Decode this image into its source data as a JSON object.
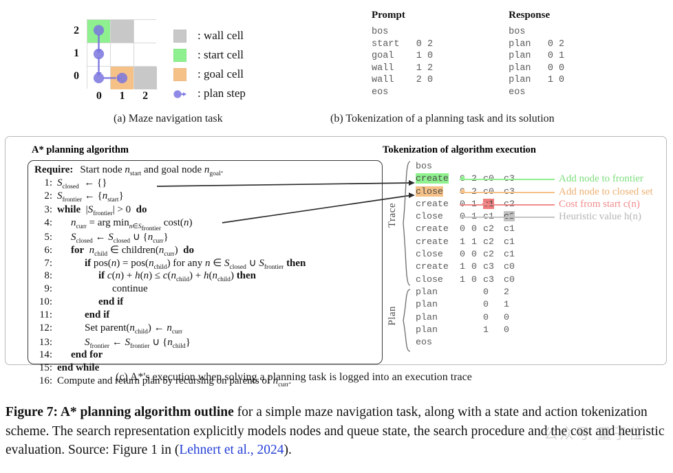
{
  "maze": {
    "y_labels": [
      "2",
      "1",
      "0"
    ],
    "x_labels": [
      "0",
      "1",
      "2"
    ],
    "colors": {
      "wall": "#c8c8c8",
      "start": "#8ef08e",
      "goal": "#f5c187",
      "plan_step": "#7b76e0",
      "empty": "#ffffff"
    },
    "cells": [
      [
        "start",
        "wall",
        "empty"
      ],
      [
        "empty",
        "empty",
        "empty"
      ],
      [
        "empty",
        "goal",
        "wall"
      ]
    ]
  },
  "legend": {
    "items": [
      {
        "icon": "gray-square-swatch",
        "label": ": wall cell"
      },
      {
        "icon": "green-square-swatch",
        "label": ": start cell"
      },
      {
        "icon": "orange-square-swatch",
        "label": ": goal cell"
      },
      {
        "icon": "purple-dot-arrow-icon",
        "label": ": plan step"
      }
    ]
  },
  "tokenization_task": {
    "prompt_header": "Prompt",
    "response_header": "Response",
    "prompt_lines": [
      "bos",
      "start   0 2",
      "goal    1 0",
      "wall    1 2",
      "wall    2 0",
      "eos"
    ],
    "response_lines": [
      "bos",
      "plan   0 2",
      "plan   0 1",
      "plan   0 0",
      "plan   1 0",
      "eos"
    ]
  },
  "subcaptions": {
    "a": "(a) Maze navigation task",
    "b": "(b) Tokenization of a planning task and its solution",
    "c": "(c) A*'s execution when solving a planning task is logged into an execution trace"
  },
  "panel_c": {
    "algo_title": "A* planning algorithm",
    "tok_title": "Tokenization of algorithm execution",
    "algo_lines": [
      {
        "num": "Require:",
        "require": true,
        "indent": 0,
        "html": "<span style=\"margin-left:5px\">Start node <i class='mv'>n</i><sub>start</sub> and goal node <i class='mv'>n</i><sub>goal</sub>.</span>"
      },
      {
        "num": "1:",
        "indent": 0,
        "html": "<i class='cal'>S</i><sub>closed</sub> &nbsp;&#8592; {}"
      },
      {
        "num": "2:",
        "indent": 0,
        "html": "<i class='cal'>S</i><sub>frontier</sub> &#8592; {<i class='mv'>n</i><sub>start</sub>}"
      },
      {
        "num": "3:",
        "indent": 0,
        "html": "<b class='kw'>while</b> &nbsp;|<i class='cal'>S</i><sub>frontier</sub>| &gt; 0 &nbsp;<b class='kw'>do</b>"
      },
      {
        "num": "4:",
        "indent": 1,
        "html": "<i class='mv'>n</i><sub>curr</sub> = arg min<sub><i>n</i>&#8712;<i>S</i><sub>frontier</sub></sub> cost(<i class='mv'>n</i>)"
      },
      {
        "num": "5:",
        "indent": 1,
        "html": "<i class='cal'>S</i><sub>closed</sub> &#8592; <i class='cal'>S</i><sub>closed</sub> &#8746; {<i class='mv'>n</i><sub>curr</sub>}"
      },
      {
        "num": "6:",
        "indent": 1,
        "html": "<b class='kw'>for</b> &nbsp;<i class='mv'>n</i><sub>child</sub> &#8712; children(<i class='mv'>n</i><sub>curr</sub>) &nbsp;<b class='kw'>do</b>"
      },
      {
        "num": "7:",
        "indent": 2,
        "html": "<b class='kw'>if</b> pos(<i class='mv'>n</i>) = pos(<i class='mv'>n</i><sub>child</sub>) for any <i class='mv'>n</i> &#8712; <i class='cal'>S</i><sub>closed</sub> &#8746; <i class='cal'>S</i><sub>frontier</sub> <b class='kw'>then</b>"
      },
      {
        "num": "8:",
        "indent": 3,
        "html": "<b class='kw'>if</b> <i class='mv'>c</i>(<i class='mv'>n</i>) + <i class='mv'>h</i>(<i class='mv'>n</i>) &#8804; <i class='mv'>c</i>(<i class='mv'>n</i><sub>child</sub>) + <i class='mv'>h</i>(<i class='mv'>n</i><sub>child</sub>) <b class='kw'>then</b>"
      },
      {
        "num": "9:",
        "indent": 4,
        "html": "continue"
      },
      {
        "num": "10:",
        "indent": 3,
        "html": "<b class='kw'>end if</b>"
      },
      {
        "num": "11:",
        "indent": 2,
        "html": "<b class='kw'>end if</b>"
      },
      {
        "num": "12:",
        "indent": 2,
        "html": "Set parent(<i class='mv'>n</i><sub>child</sub>) &#8592; <i class='mv'>n</i><sub>curr</sub>"
      },
      {
        "num": "13:",
        "indent": 2,
        "html": "<i class='cal'>S</i><sub>frontier</sub> &#8592; <i class='cal'>S</i><sub>frontier</sub> &#8746; {<i class='mv'>n</i><sub>child</sub>}"
      },
      {
        "num": "14:",
        "indent": 1,
        "html": "<b class='kw'>end for</b>"
      },
      {
        "num": "15:",
        "indent": 0,
        "html": "<b class='kw'>end while</b>"
      },
      {
        "num": "16:",
        "indent": 0,
        "html": "Compute and return plan by recursing on parents of <i class='mv'>n</i><sub>curr</sub>."
      }
    ],
    "trace_label": "Trace",
    "plan_label": "Plan",
    "trace_rows": [
      {
        "op": "bos",
        "args": [],
        "hl": []
      },
      {
        "op": "create",
        "args": [
          "0",
          "2",
          "c0",
          "c3"
        ],
        "hl": [
          "op"
        ],
        "annot": "Add node to frontier",
        "annot_class": "an-green",
        "strike": "#8ef08e"
      },
      {
        "op": "close",
        "args": [
          "0",
          "2",
          "c0",
          "c3"
        ],
        "hl": [
          "op"
        ],
        "annot": "Add node to closed set",
        "annot_class": "an-orange",
        "strike": "#f5c187"
      },
      {
        "op": "create",
        "args": [
          "0",
          "1",
          "c1",
          "c2"
        ],
        "hl": [
          "a3"
        ],
        "annot": "Cost from start c(n)",
        "annot_class": "an-red",
        "strike": "#f08b8b"
      },
      {
        "op": "close",
        "args": [
          "0",
          "1",
          "c1",
          "c2"
        ],
        "hl": [
          "a4"
        ],
        "annot": "Heuristic value h(n)",
        "annot_class": "an-gray",
        "strike": "#c2c2c2"
      },
      {
        "op": "create",
        "args": [
          "0",
          "0",
          "c2",
          "c1"
        ],
        "hl": []
      },
      {
        "op": "create",
        "args": [
          "1",
          "1",
          "c2",
          "c1"
        ],
        "hl": []
      },
      {
        "op": "close",
        "args": [
          "0",
          "0",
          "c2",
          "c1"
        ],
        "hl": []
      },
      {
        "op": "create",
        "args": [
          "1",
          "0",
          "c3",
          "c0"
        ],
        "hl": []
      },
      {
        "op": "close",
        "args": [
          "1",
          "0",
          "c3",
          "c0"
        ],
        "hl": []
      }
    ],
    "plan_rows": [
      {
        "op": "plan",
        "args": [
          "",
          "",
          "0",
          "2"
        ]
      },
      {
        "op": "plan",
        "args": [
          "",
          "",
          "0",
          "1"
        ]
      },
      {
        "op": "plan",
        "args": [
          "",
          "",
          "0",
          "0"
        ]
      },
      {
        "op": "plan",
        "args": [
          "",
          "",
          "1",
          "0"
        ]
      },
      {
        "op": "eos",
        "args": []
      }
    ]
  },
  "caption": {
    "figure_label": "Figure 7",
    "bold_part": "A* planning algorithm outline",
    "body_1": " for a simple maze navigation task, along with a state and action tokenization scheme. The search representation explicitly models nodes and queue state, the search procedure and the cost and heuristic evaluation. Source: Figure 1 in (",
    "citation": "Lehnert et al., 2024",
    "body_2": ")."
  },
  "watermark": {
    "text": "公众号 量子位"
  }
}
